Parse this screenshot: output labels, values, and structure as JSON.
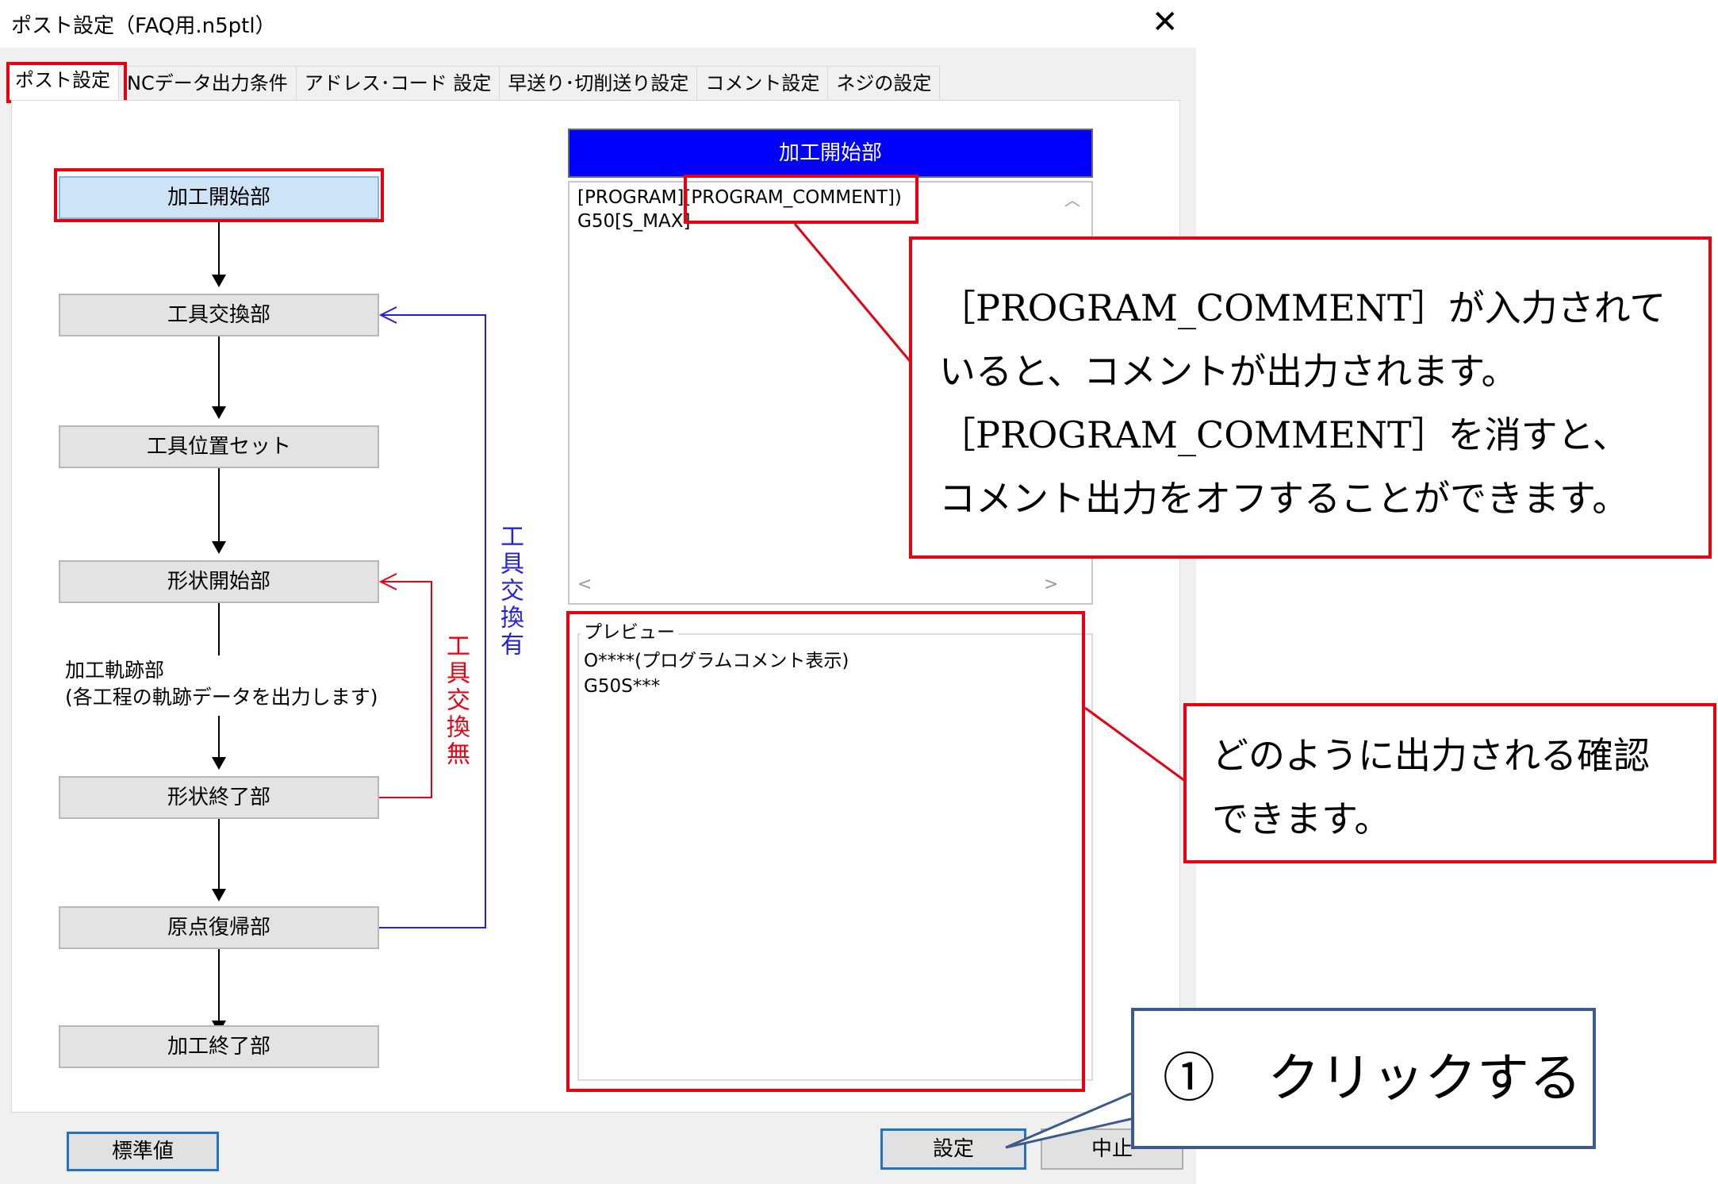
{
  "window": {
    "title": "ポスト設定（FAQ用.n5ptl）",
    "close_glyph": "✕"
  },
  "tabs": [
    "ポスト設定",
    "NCデータ出力条件",
    "アドレス･コード 設定",
    "早送り･切削送り設定",
    "コメント設定",
    "ネジの設定"
  ],
  "flow": {
    "start": "加工開始部",
    "tool_change": "工具交換部",
    "tool_position": "工具位置セット",
    "shape_start": "形状開始部",
    "path_line1": "加工軌跡部",
    "path_line2": "(各工程の軌跡データを出力します)",
    "shape_end": "形状終了部",
    "home_return": "原点復帰部",
    "end": "加工終了部",
    "loop_with_tool_change": "工具交換有",
    "loop_without_tool_change": "工具交換無"
  },
  "editor": {
    "header": "加工開始部",
    "line1_prefix": "[PROGRAM]",
    "line1_comment": "[PROGRAM_COMMENT])",
    "line2": "G50[S_MAX]",
    "scroll_up": "︿",
    "scroll_left": "<",
    "scroll_right": ">"
  },
  "preview": {
    "legend": "プレビュー",
    "line1": "O****(プログラムコメント表示)",
    "line2": "G50S***"
  },
  "buttons": {
    "default": "標準値",
    "ok": "設定",
    "cancel": "中止"
  },
  "annotations": {
    "comment_note_line1": "［PROGRAM_COMMENT］が入力されて",
    "comment_note_line2": "いると、コメントが出力されます。",
    "comment_note_line3": "［PROGRAM_COMMENT］を消すと、",
    "comment_note_line4": "コメント出力をオフすることができます。",
    "preview_note_line1": "どのように出力される確認",
    "preview_note_line2": "できます。",
    "click_note": "①　クリックする"
  },
  "colors": {
    "highlight_red": "#e60012",
    "header_blue": "#0000ff",
    "arrow_blue": "#2222dd",
    "arrow_red": "#e60012",
    "callout_navy": "#3d5a8c"
  }
}
